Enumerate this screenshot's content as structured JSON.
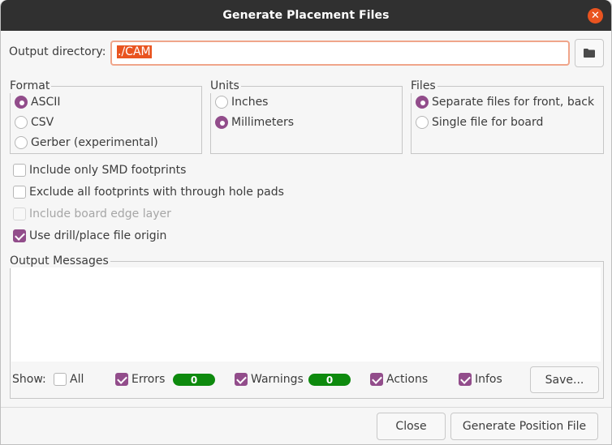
{
  "window": {
    "title": "Generate Placement Files",
    "close_icon": "close-icon"
  },
  "output_directory": {
    "label": "Output directory:",
    "value": "./CAM",
    "browse_icon": "folder-icon"
  },
  "format": {
    "title": "Format",
    "options": [
      {
        "label": "ASCII",
        "selected": true
      },
      {
        "label": "CSV",
        "selected": false
      },
      {
        "label": "Gerber (experimental)",
        "selected": false
      }
    ]
  },
  "units": {
    "title": "Units",
    "options": [
      {
        "label": "Inches",
        "selected": false
      },
      {
        "label": "Millimeters",
        "selected": true
      }
    ]
  },
  "files": {
    "title": "Files",
    "options": [
      {
        "label": "Separate files for front, back",
        "selected": true
      },
      {
        "label": "Single file for board",
        "selected": false
      }
    ]
  },
  "options": [
    {
      "label": "Include only SMD footprints",
      "checked": false,
      "enabled": true
    },
    {
      "label": "Exclude all footprints with through hole pads",
      "checked": false,
      "enabled": true
    },
    {
      "label": "Include board edge layer",
      "checked": false,
      "enabled": false
    },
    {
      "label": "Use drill/place file origin",
      "checked": true,
      "enabled": true
    }
  ],
  "messages": {
    "title": "Output Messages",
    "show_label": "Show:",
    "filters": [
      {
        "label": "All",
        "checked": false
      },
      {
        "label": "Errors",
        "checked": true,
        "count": "0"
      },
      {
        "label": "Warnings",
        "checked": true,
        "count": "0"
      },
      {
        "label": "Actions",
        "checked": true
      },
      {
        "label": "Infos",
        "checked": true
      }
    ],
    "save_label": "Save..."
  },
  "buttons": {
    "close": "Close",
    "generate": "Generate Position File"
  },
  "colors": {
    "accent": "#924d8b",
    "selection": "#e95420",
    "badge": "#0e8a0e",
    "titlebar": "#303030"
  }
}
